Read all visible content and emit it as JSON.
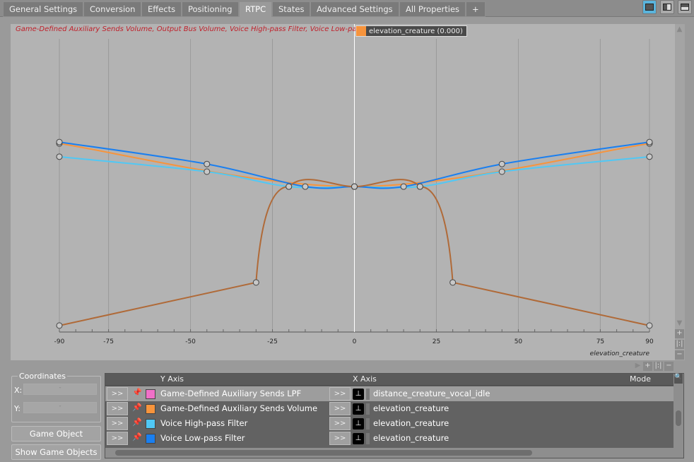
{
  "tabs": [
    "General Settings",
    "Conversion",
    "Effects",
    "Positioning",
    "RTPC",
    "States",
    "Advanced Settings",
    "All Properties",
    "+"
  ],
  "active_tab": "RTPC",
  "graph": {
    "title": "Game-Defined Auxiliary Sends Volume, Output Bus Volume, Voice High-pass Filter, Voice Low-pass Filter",
    "legend": "elevation_creature (0.000)",
    "legend_color": "#f7943c"
  },
  "chart_data": {
    "type": "line",
    "xlabel": "elevation_creature",
    "xlim": [
      -90,
      90
    ],
    "ylim": [
      0,
      1
    ],
    "grid": true,
    "xticks": [
      -90,
      -75,
      -50,
      -25,
      0,
      25,
      50,
      75,
      90
    ],
    "cursor_x": 0,
    "series": [
      {
        "color": "#f7943c",
        "points": [
          [
            -90,
            0.643
          ],
          [
            0,
            0.496
          ],
          [
            90,
            0.643
          ]
        ]
      },
      {
        "color": "#50c8f5",
        "points": [
          [
            -90,
            0.598
          ],
          [
            -45,
            0.547
          ],
          [
            -20,
            0.496
          ],
          [
            0,
            0.496
          ],
          [
            20,
            0.496
          ],
          [
            45,
            0.547
          ],
          [
            90,
            0.598
          ]
        ]
      },
      {
        "color": "#1a7ff0",
        "points": [
          [
            -90,
            0.648
          ],
          [
            -45,
            0.573
          ],
          [
            -15,
            0.496
          ],
          [
            0,
            0.496
          ],
          [
            15,
            0.496
          ],
          [
            45,
            0.573
          ],
          [
            90,
            0.648
          ]
        ]
      },
      {
        "color": "#b06a38",
        "points": [
          [
            -90,
            0.022
          ],
          [
            -30,
            0.169
          ],
          [
            -20,
            0.496
          ],
          [
            0,
            0.496
          ],
          [
            20,
            0.496
          ],
          [
            30,
            0.169
          ],
          [
            90,
            0.022
          ]
        ]
      }
    ]
  },
  "coordinates": {
    "label": "Coordinates",
    "x_label": "X:",
    "y_label": "Y:",
    "x_value": "-",
    "y_value": "-"
  },
  "buttons": {
    "explorer": "Game Object Explorer...",
    "show": "Show Game Objects",
    "expand": ">>"
  },
  "list": {
    "headers": {
      "y": "Y Axis",
      "x": "X Axis",
      "mode": "Mode"
    },
    "rows": [
      {
        "y": "Game-Defined Auxiliary Sends LPF",
        "color": "#f070c8",
        "x": "distance_creature_vocal_idle",
        "selected": true
      },
      {
        "y": "Game-Defined Auxiliary Sends Volume",
        "color": "#f7943c",
        "x": "elevation_creature"
      },
      {
        "y": "Voice High-pass Filter",
        "color": "#50c8f5",
        "x": "elevation_creature"
      },
      {
        "y": "Voice Low-pass Filter",
        "color": "#1a7ff0",
        "x": "elevation_creature"
      }
    ]
  }
}
